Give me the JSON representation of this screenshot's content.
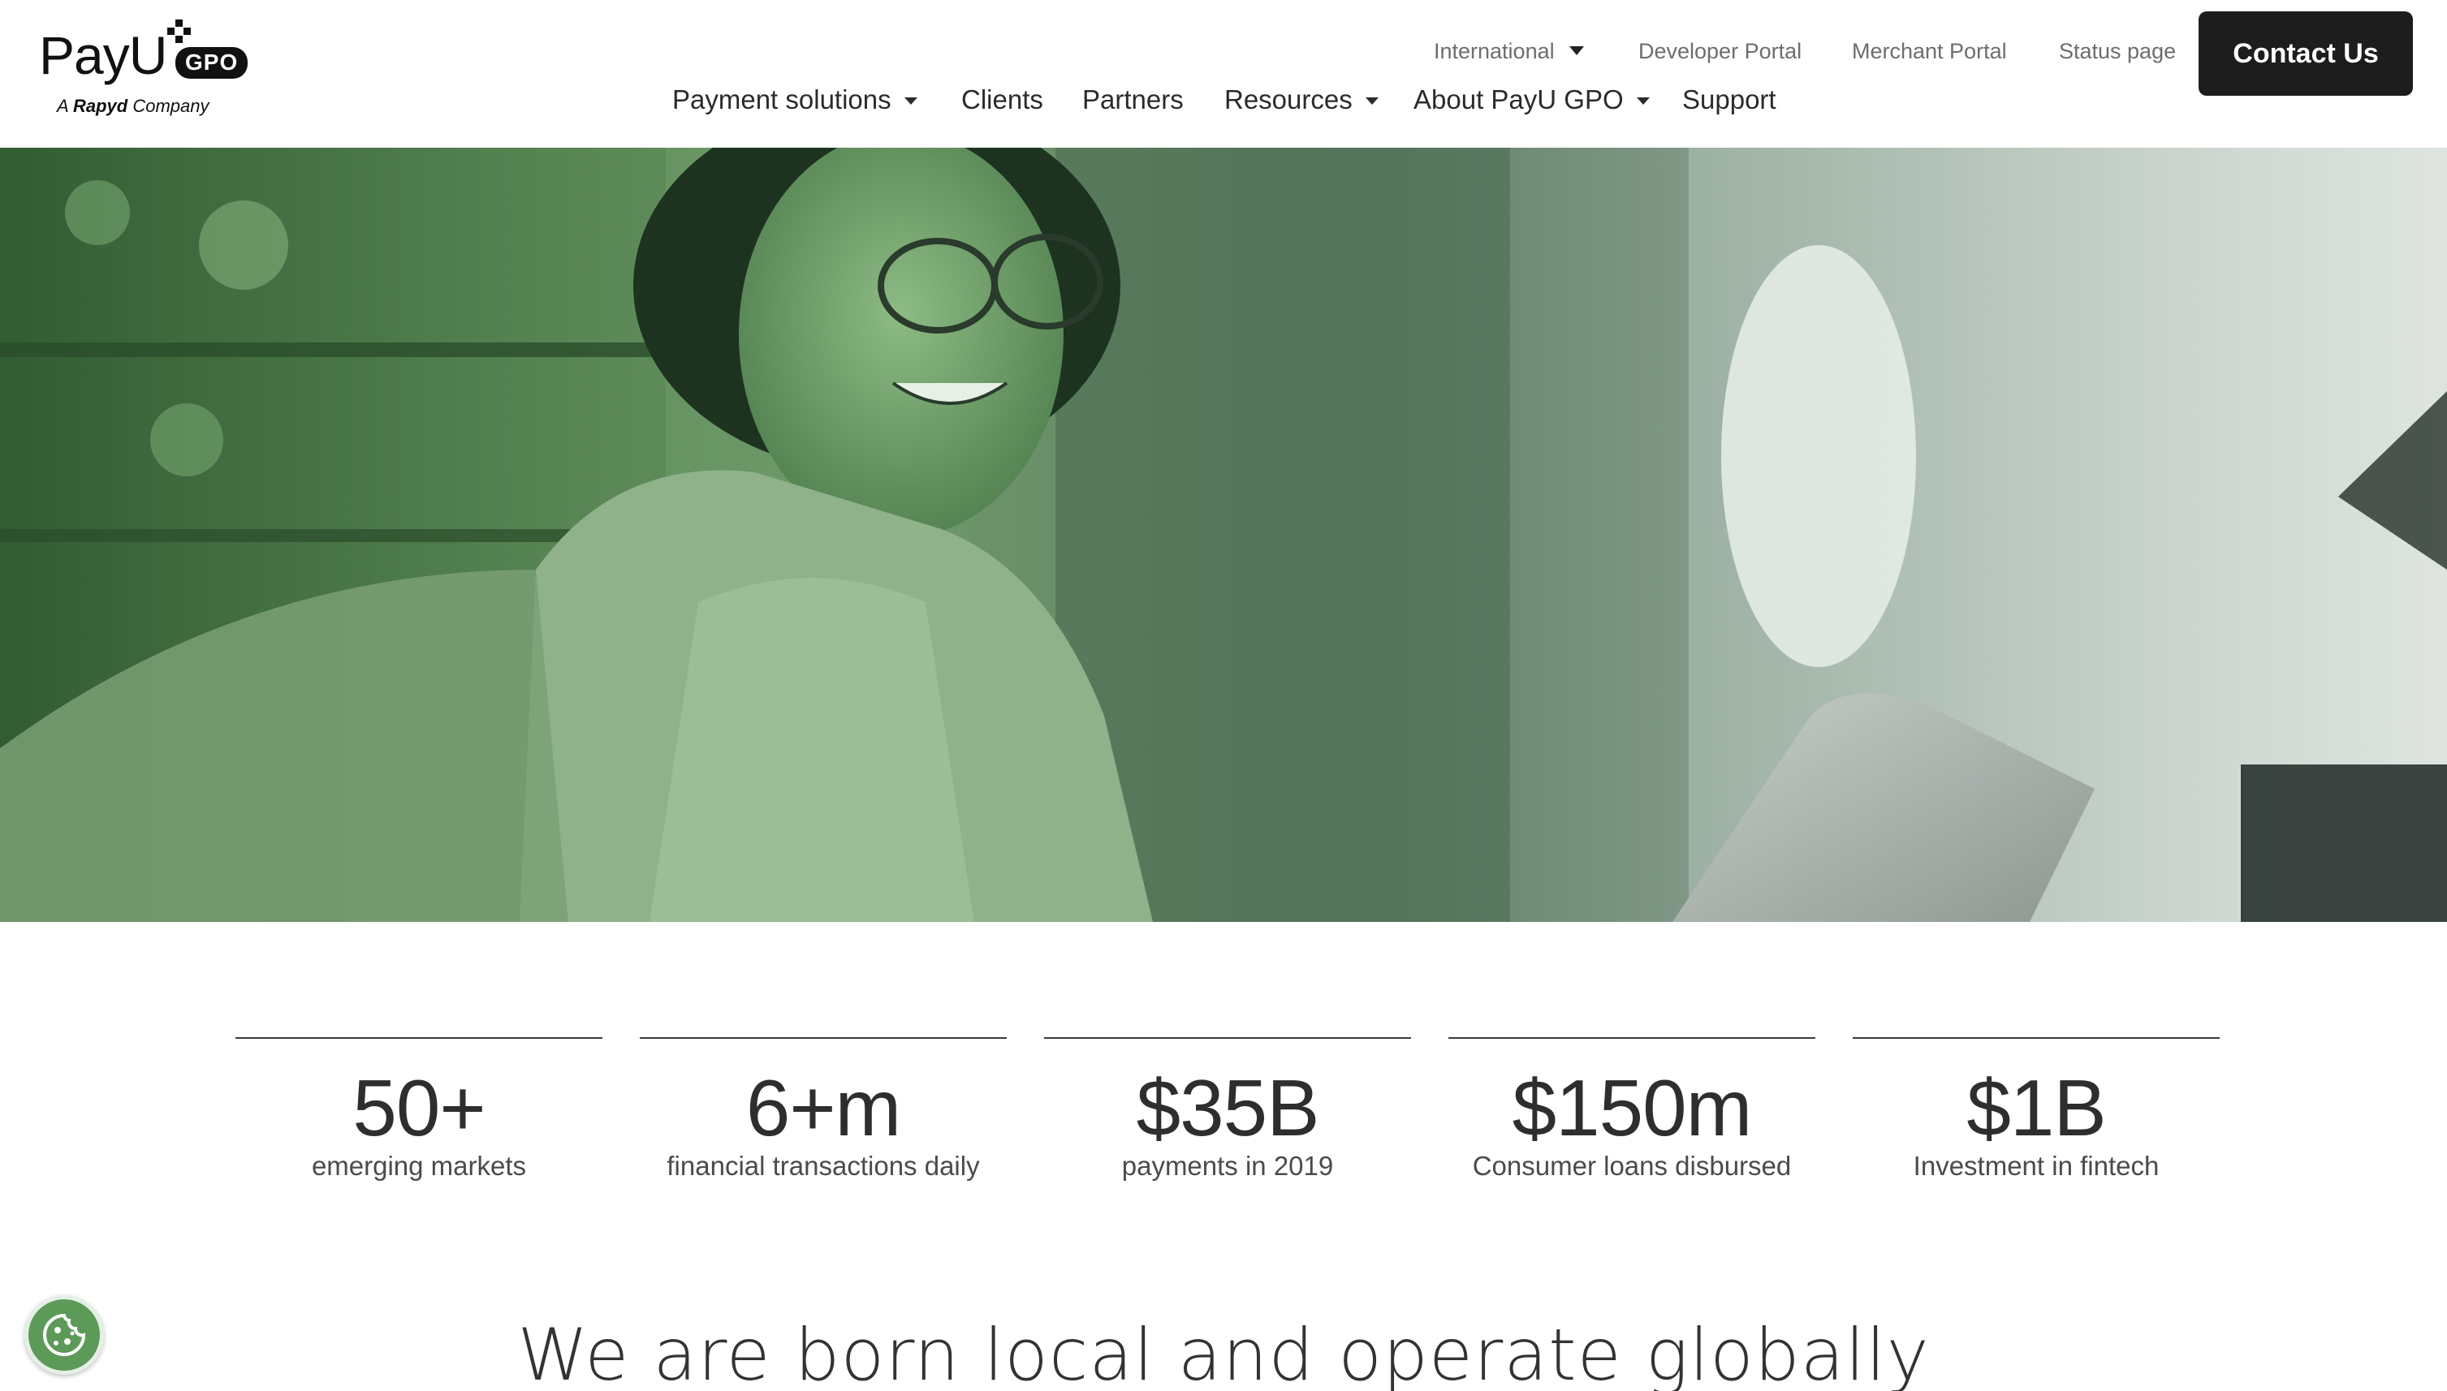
{
  "brand": {
    "logo_word": "PayU",
    "logo_badge": "GPO",
    "tagline_prefix": "A",
    "tagline_brand": "Rapyd",
    "tagline_suffix": "Company"
  },
  "utility_nav": {
    "international": "International",
    "developer_portal": "Developer Portal",
    "merchant_portal": "Merchant Portal",
    "status_page": "Status page",
    "contact_us": "Contact Us"
  },
  "main_nav": {
    "payment_solutions": "Payment solutions",
    "clients": "Clients",
    "partners": "Partners",
    "resources": "Resources",
    "about": "About PayU GPO",
    "support": "Support"
  },
  "stats": [
    {
      "value": "50+",
      "label": "emerging markets"
    },
    {
      "value": "6+m",
      "label": "financial transactions daily"
    },
    {
      "value": "$35B",
      "label": "payments in 2019"
    },
    {
      "value": "$150m",
      "label": "Consumer loans disbursed"
    },
    {
      "value": "$1B",
      "label": "Investment in fintech"
    }
  ],
  "section": {
    "heading": "We are born local and operate globally"
  },
  "colors": {
    "button_dark": "#1d1d1d",
    "hero_tint": "#5e8f5a",
    "cookie": "#5c9a58"
  },
  "icons": {
    "cookie": "cookie-icon",
    "dropdown": "chevron-down-icon"
  }
}
